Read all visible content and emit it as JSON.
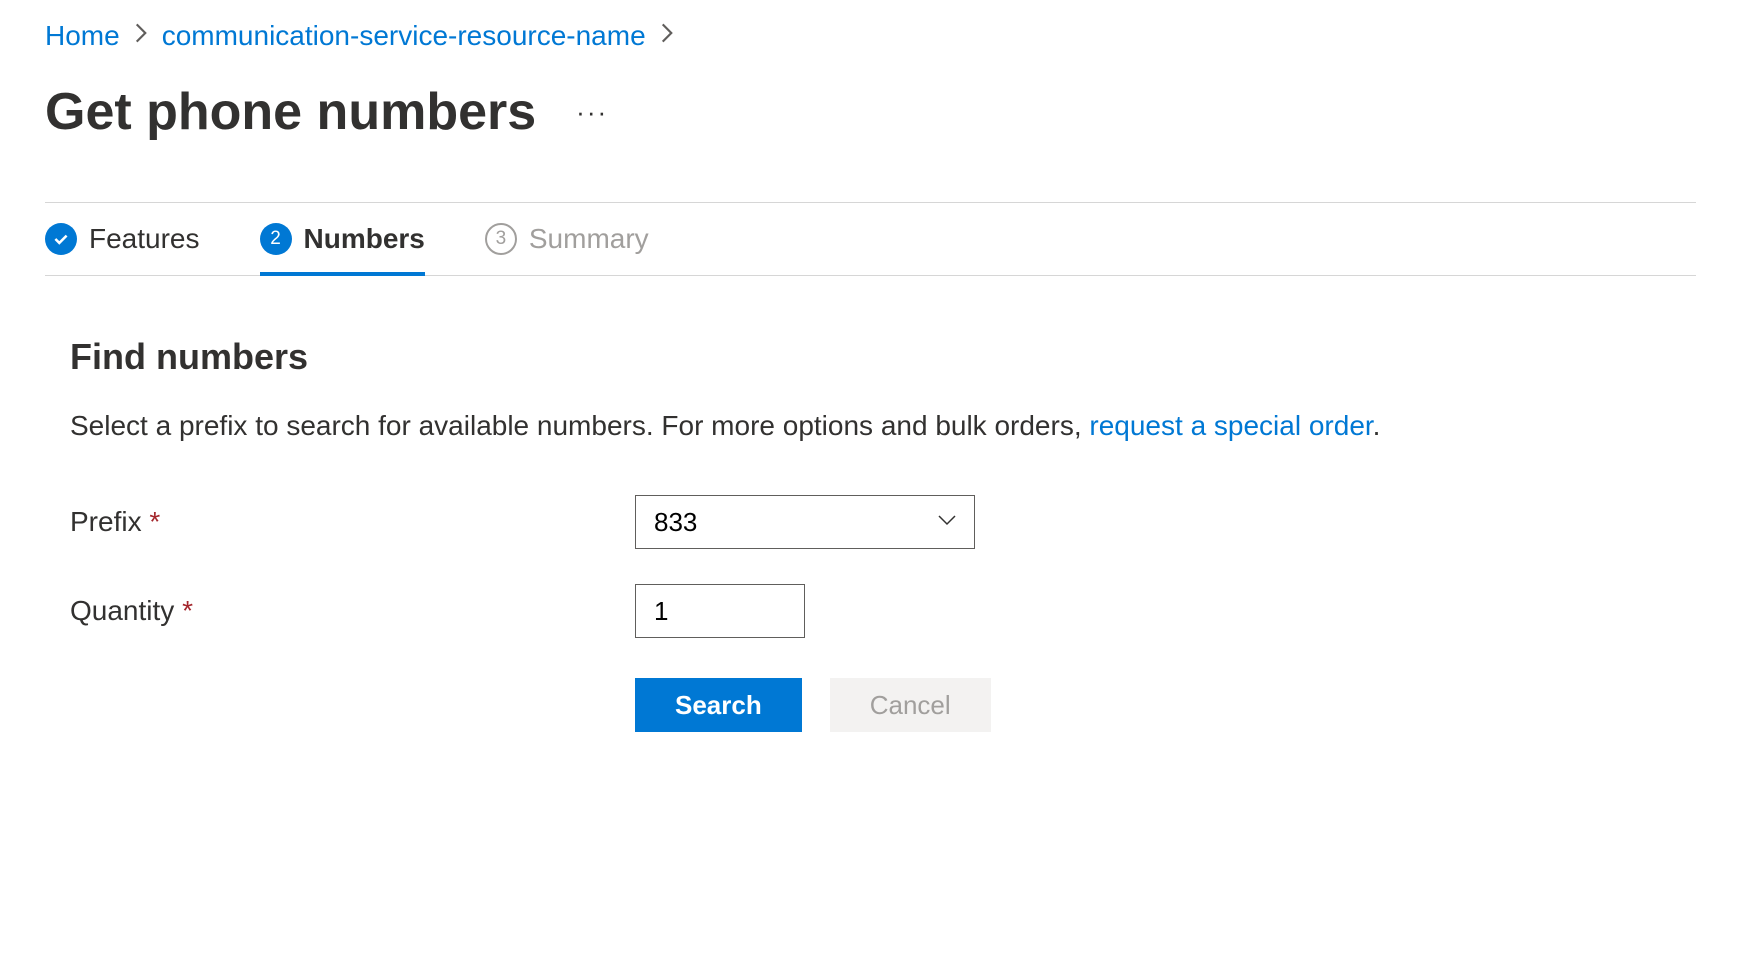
{
  "breadcrumb": {
    "home": "Home",
    "resource": "communication-service-resource-name"
  },
  "page_title": "Get phone numbers",
  "tabs": [
    {
      "label": "Features",
      "state": "completed"
    },
    {
      "label": "Numbers",
      "state": "current",
      "number": "2"
    },
    {
      "label": "Summary",
      "state": "pending",
      "number": "3"
    }
  ],
  "section": {
    "title": "Find numbers",
    "description_prefix": "Select a prefix to search for available numbers. For more options and bulk orders, ",
    "description_link": "request a special order",
    "description_suffix": "."
  },
  "form": {
    "prefix_label": "Prefix",
    "prefix_value": "833",
    "quantity_label": "Quantity",
    "quantity_value": "1"
  },
  "buttons": {
    "search": "Search",
    "cancel": "Cancel"
  }
}
